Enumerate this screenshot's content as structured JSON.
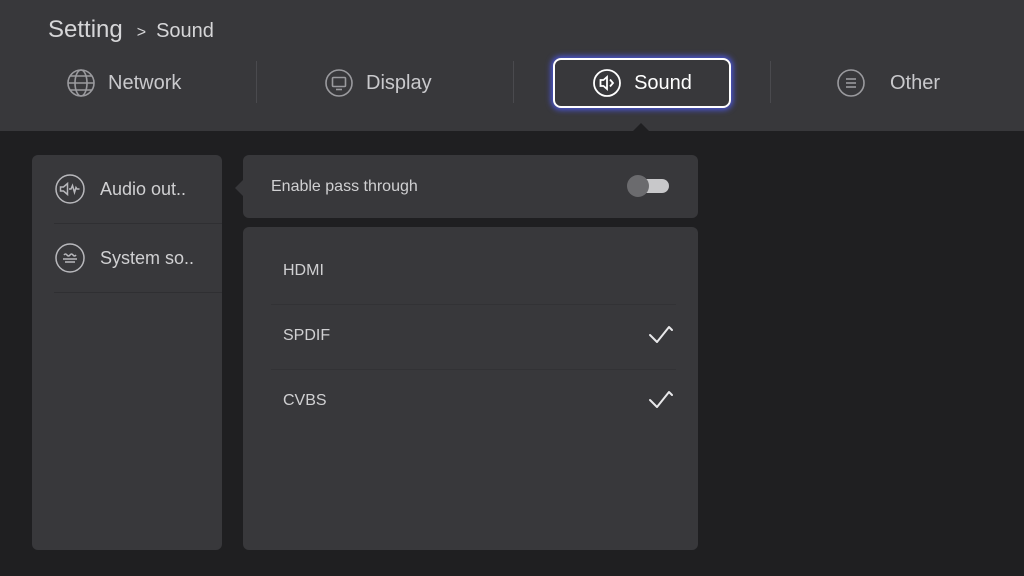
{
  "breadcrumb": {
    "root": "Setting",
    "separator": ">",
    "current": "Sound"
  },
  "tabs": [
    {
      "label": "Network",
      "icon": "globe-icon",
      "active": false
    },
    {
      "label": "Display",
      "icon": "monitor-icon",
      "active": false
    },
    {
      "label": "Sound",
      "icon": "speaker-icon",
      "active": true
    },
    {
      "label": "Other",
      "icon": "menu-icon",
      "active": false
    }
  ],
  "sidebar": {
    "items": [
      {
        "label": "Audio out..",
        "icon": "audio-output-icon",
        "selected": true
      },
      {
        "label": "System so..",
        "icon": "system-sound-icon",
        "selected": false
      }
    ]
  },
  "pass_through": {
    "label": "Enable pass through",
    "enabled": false
  },
  "outputs": [
    {
      "label": "HDMI",
      "checked": false
    },
    {
      "label": "SPDIF",
      "checked": true
    },
    {
      "label": "CVBS",
      "checked": true
    }
  ],
  "colors": {
    "accent_glow": "#4b55d8",
    "panel": "#38383b",
    "background": "#1f1f21"
  }
}
